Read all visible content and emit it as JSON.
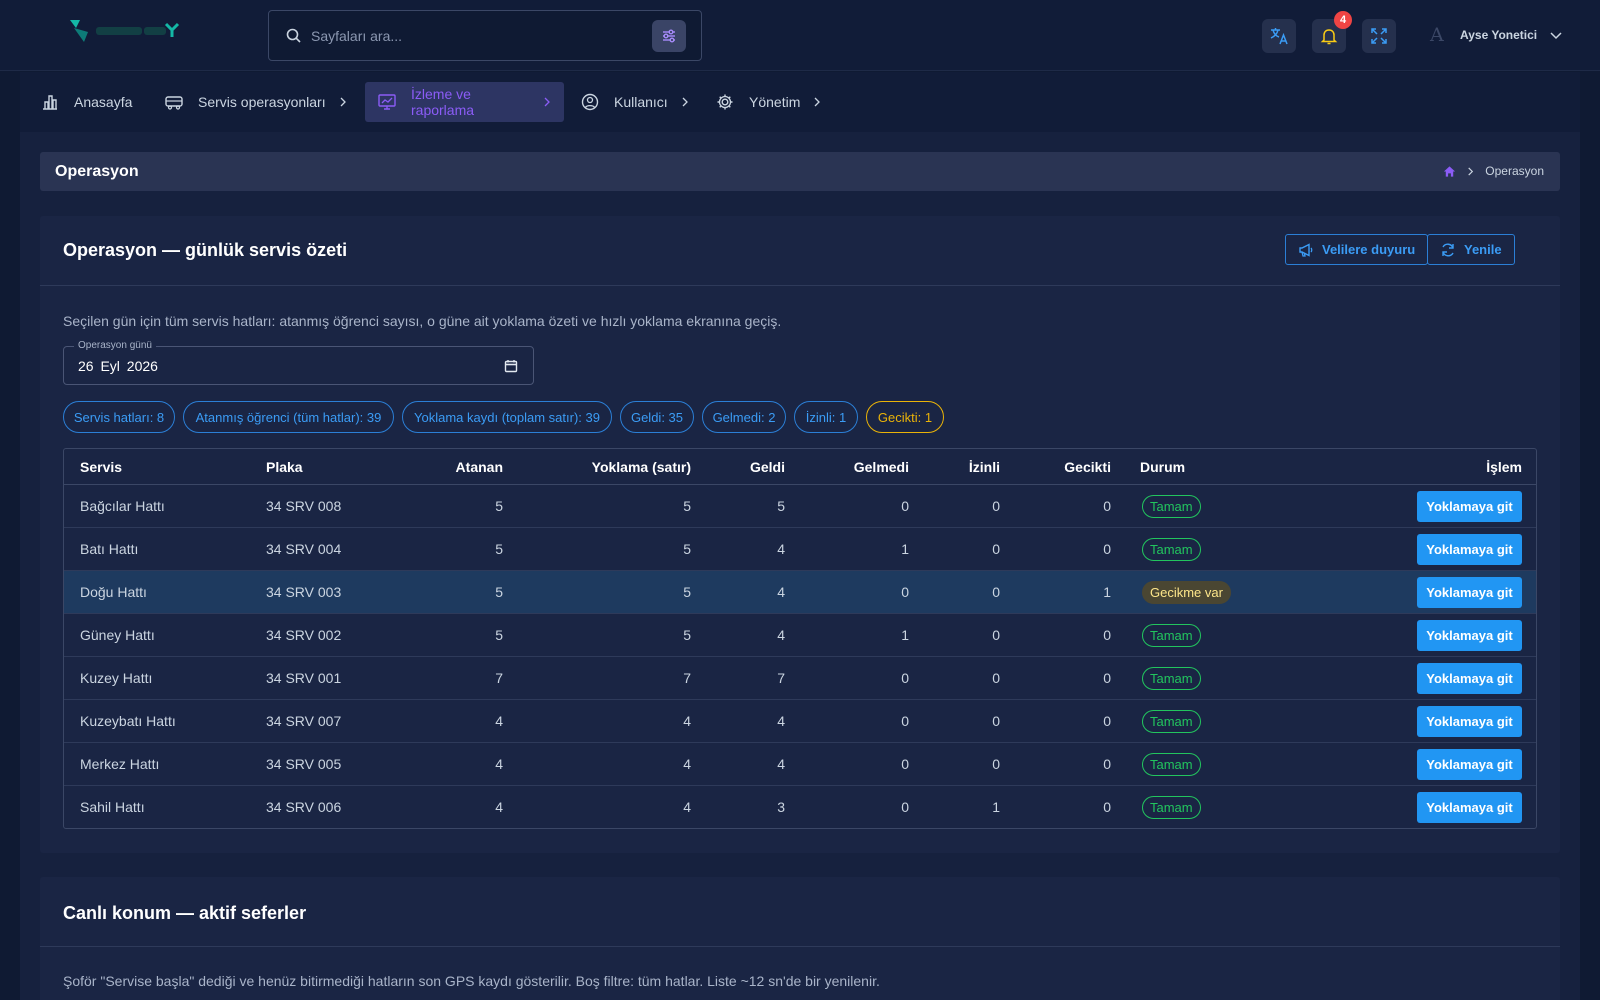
{
  "search": {
    "placeholder": "Sayfaları ara..."
  },
  "topbar": {
    "notification_count": "4",
    "user_initial": "A",
    "user_name": "Ayse Yonetici"
  },
  "nav": {
    "items": [
      {
        "label": "Anasayfa",
        "icon": "chart-bar-icon"
      },
      {
        "label": "Servis operasyonları",
        "icon": "bus-icon"
      },
      {
        "label": "İzleme ve raporlama",
        "icon": "monitor-chart-icon",
        "active": true
      },
      {
        "label": "Kullanıcı",
        "icon": "user-circle-icon"
      },
      {
        "label": "Yönetim",
        "icon": "gear-icon"
      }
    ]
  },
  "page": {
    "title": "Operasyon",
    "breadcrumb_current": "Operasyon"
  },
  "card": {
    "title": "Operasyon — günlük servis özeti",
    "announce_label": "Velilere duyuru",
    "refresh_label": "Yenile",
    "description": "Seçilen gün için tüm servis hatları: atanmış öğrenci sayısı, o güne ait yoklama özeti ve hızlı yoklama ekranına geçiş.",
    "date_label": "Operasyon günü",
    "date_value": "26 Eyl 2026"
  },
  "chips": [
    "Servis hatları: 8",
    "Atanmış öğrenci (tüm hatlar): 39",
    "Yoklama kaydı (toplam satır): 39",
    "Geldi: 35",
    "Gelmedi: 2",
    "İzinli: 1",
    "Gecikti: 1"
  ],
  "table": {
    "headers": [
      "Servis",
      "Plaka",
      "Atanan",
      "Yoklama (satır)",
      "Geldi",
      "Gelmedi",
      "İzinli",
      "Gecikti",
      "Durum",
      "İşlem"
    ],
    "action_label": "Yoklamaya git",
    "rows": [
      [
        "Bağcılar Hattı",
        "34 SRV 008",
        "5",
        "5",
        "5",
        "0",
        "0",
        "0",
        "Tamam"
      ],
      [
        "Batı Hattı",
        "34 SRV 004",
        "5",
        "5",
        "4",
        "1",
        "0",
        "0",
        "Tamam"
      ],
      [
        "Doğu Hattı",
        "34 SRV 003",
        "5",
        "5",
        "4",
        "0",
        "0",
        "1",
        "Gecikme var"
      ],
      [
        "Güney Hattı",
        "34 SRV 002",
        "5",
        "5",
        "4",
        "1",
        "0",
        "0",
        "Tamam"
      ],
      [
        "Kuzey Hattı",
        "34 SRV 001",
        "7",
        "7",
        "7",
        "0",
        "0",
        "0",
        "Tamam"
      ],
      [
        "Kuzeybatı Hattı",
        "34 SRV 007",
        "4",
        "4",
        "4",
        "0",
        "0",
        "0",
        "Tamam"
      ],
      [
        "Merkez Hattı",
        "34 SRV 005",
        "4",
        "4",
        "4",
        "0",
        "0",
        "0",
        "Tamam"
      ],
      [
        "Sahil Hattı",
        "34 SRV 006",
        "4",
        "4",
        "3",
        "0",
        "1",
        "0",
        "Tamam"
      ]
    ]
  },
  "live": {
    "title": "Canlı konum — aktif seferler",
    "description": "Şoför \"Servise başla\" dediği ve henüz bitirmediği hatların son GPS kaydı gösterilir. Boş filtre: tüm hatlar. Liste ~12 sn'de bir yenilenir."
  },
  "colors": {
    "accent": "#2196f3",
    "active_nav": "#8b5cf6",
    "ok": "#22c55e",
    "warn": "#eab308",
    "danger": "#ef4444"
  }
}
